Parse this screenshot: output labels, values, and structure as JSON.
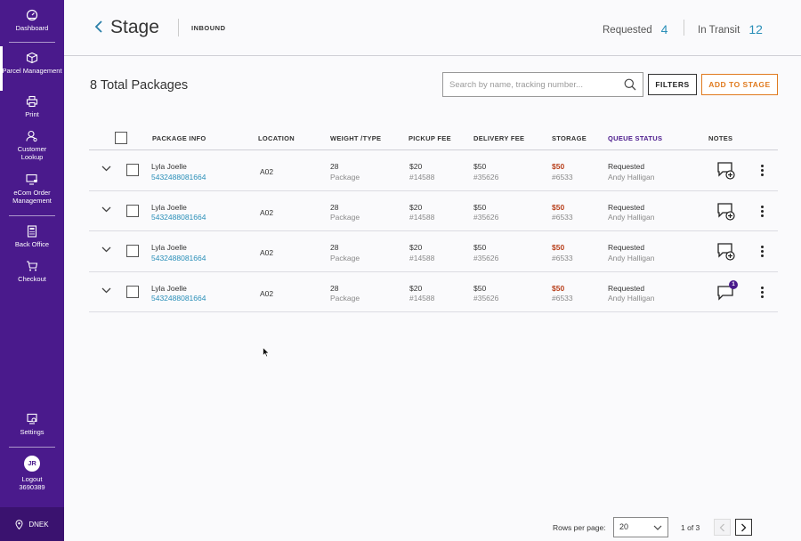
{
  "sidebar": {
    "items": [
      {
        "label": "Dashboard",
        "icon": "dashboard-gauge-icon"
      },
      {
        "label": "Parcel Management",
        "icon": "box-icon",
        "active": true
      },
      {
        "label": "Print",
        "icon": "printer-icon"
      },
      {
        "label": "Customer Lookup",
        "icon": "user-search-icon"
      },
      {
        "label": "eCom Order Management",
        "icon": "monitor-cart-icon"
      },
      {
        "label": "Back Office",
        "icon": "calculator-icon"
      },
      {
        "label": "Checkout",
        "icon": "cart-icon"
      }
    ],
    "settings_label": "Settings",
    "user": {
      "initials": "JR",
      "logout_label": "Logout",
      "id": "3690389"
    },
    "location": "DNEK"
  },
  "header": {
    "title": "Stage",
    "subtitle": "INBOUND",
    "stats": [
      {
        "label": "Requested",
        "value": "4"
      },
      {
        "label": "In Transit",
        "value": "12"
      }
    ]
  },
  "toolbar": {
    "total": "8 Total Packages",
    "search_placeholder": "Search by name, tracking number...",
    "filters_label": "FILTERS",
    "add_label": "ADD TO STAGE"
  },
  "table": {
    "headers": {
      "package": "PACKAGE  INFO",
      "location": "LOCATION",
      "weight": "WEIGHT /TYPE",
      "pickup": "PICKUP FEE",
      "delivery": "DELIVERY FEE",
      "storage": "STORAGE",
      "status": "QUEUE STATUS",
      "notes": "NOTES"
    },
    "rows": [
      {
        "name": "Lyla Joelle",
        "tracking": "5432488081664",
        "location": "A02",
        "weight": "28",
        "type": "Package",
        "pickup_fee": "$20",
        "pickup_ref": "#14588",
        "delivery_fee": "$50",
        "delivery_ref": "#35626",
        "storage_fee": "$50",
        "storage_ref": "#6533",
        "status": "Requested",
        "agent": "Andy Halligan",
        "note_count": null
      },
      {
        "name": "Lyla Joelle",
        "tracking": "5432488081664",
        "location": "A02",
        "weight": "28",
        "type": "Package",
        "pickup_fee": "$20",
        "pickup_ref": "#14588",
        "delivery_fee": "$50",
        "delivery_ref": "#35626",
        "storage_fee": "$50",
        "storage_ref": "#6533",
        "status": "Requested",
        "agent": "Andy Halligan",
        "note_count": null
      },
      {
        "name": "Lyla Joelle",
        "tracking": "5432488081664",
        "location": "A02",
        "weight": "28",
        "type": "Package",
        "pickup_fee": "$20",
        "pickup_ref": "#14588",
        "delivery_fee": "$50",
        "delivery_ref": "#35626",
        "storage_fee": "$50",
        "storage_ref": "#6533",
        "status": "Requested",
        "agent": "Andy Halligan",
        "note_count": null
      },
      {
        "name": "Lyla Joelle",
        "tracking": "5432488081664",
        "location": "A02",
        "weight": "28",
        "type": "Package",
        "pickup_fee": "$20",
        "pickup_ref": "#14588",
        "delivery_fee": "$50",
        "delivery_ref": "#35626",
        "storage_fee": "$50",
        "storage_ref": "#6533",
        "status": "Requested",
        "agent": "Andy Halligan",
        "note_count": "1"
      }
    ]
  },
  "pagination": {
    "rows_label": "Rows per page:",
    "rows_value": "20",
    "page_info": "1 of 3"
  },
  "colors": {
    "sidebar": "#4a1a8c",
    "accent_link": "#2a8fb8",
    "add_button": "#e07a1e",
    "storage_fee": "#b8401c"
  }
}
